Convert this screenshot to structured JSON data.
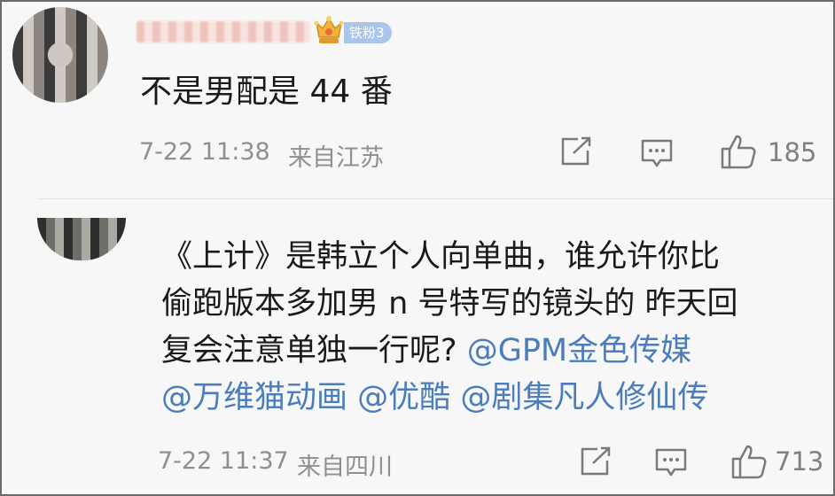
{
  "comments": [
    {
      "username": "",
      "badge": "铁粉3",
      "text": "不是男配是 44 番",
      "time": "7-22 11:38",
      "location": "来自江苏",
      "likes": "185"
    },
    {
      "text_line1": "《上计》是韩立个人向单曲，谁允许你比",
      "text_line2": "偷跑版本多加男 n 号特写的镜头的 昨天回",
      "text_line3_plain": "复会注意单独一行呢? ",
      "mentions": [
        "@GPM金色传媒",
        "@万维猫动画",
        "@优酷",
        "@剧集凡人修仙传"
      ],
      "time": "7-22 11:37",
      "location": "来自四川",
      "likes": "713"
    }
  ],
  "icons": [
    "share-icon",
    "comment-icon",
    "thumbs-up-icon",
    "crown-icon"
  ],
  "colors": {
    "mention": "#4a7db9",
    "badge": "#a9c6ea",
    "meta": "#8f8f8f"
  }
}
